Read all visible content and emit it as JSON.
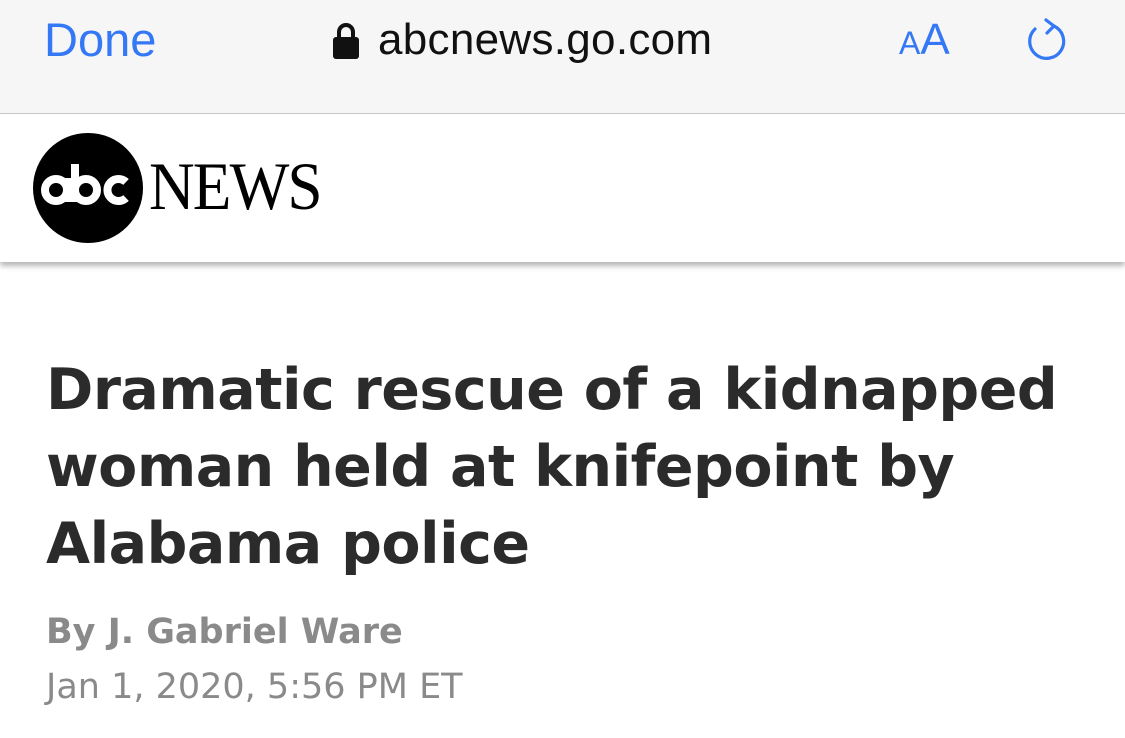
{
  "browser": {
    "done_label": "Done",
    "url": "abcnews.go.com",
    "text_size_small": "A",
    "text_size_large": "A",
    "accent_color": "#3478f6",
    "icons": [
      "lock-icon",
      "reload-icon"
    ]
  },
  "site": {
    "logo_text": "abc",
    "wordmark": "NEWS"
  },
  "article": {
    "headline": "Dramatic rescue of a kidnapped woman held at knifepoint by Alabama police",
    "byline_prefix": "By ",
    "author": "J. Gabriel Ware",
    "date": "Jan 1, 2020, 5:56 PM ET"
  }
}
